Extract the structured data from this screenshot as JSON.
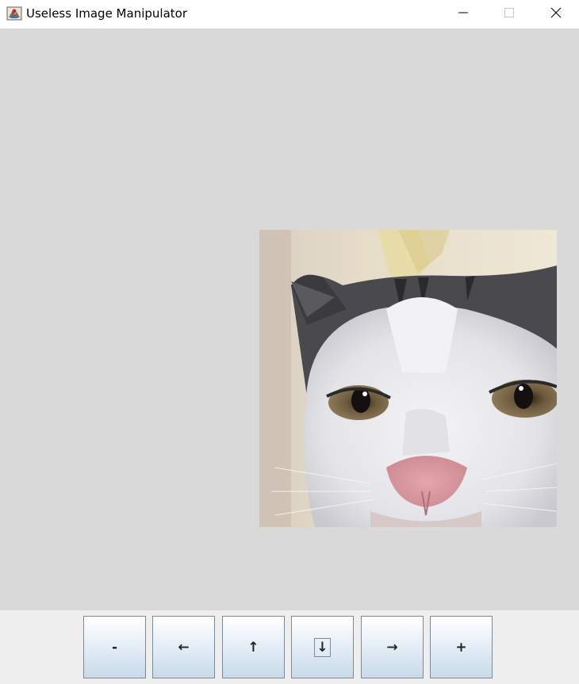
{
  "window": {
    "title": "Useless Image Manipulator",
    "controls": {
      "minimize_icon": "minimize-icon",
      "maximize_icon": "maximize-icon",
      "close_icon": "close-icon"
    }
  },
  "canvas": {
    "background": "#d9d9d9",
    "image": "cat-photo"
  },
  "toolbar": {
    "buttons": [
      {
        "label": "-",
        "action": "zoom-out"
      },
      {
        "label": "←",
        "action": "move-left"
      },
      {
        "label": "↑",
        "action": "move-up"
      },
      {
        "label": "↓",
        "action": "move-down",
        "focused": true
      },
      {
        "label": "→",
        "action": "move-right"
      },
      {
        "label": "+",
        "action": "zoom-in"
      }
    ]
  },
  "colors": {
    "button_gradient_top": "#ffffff",
    "button_gradient_bottom": "#c8daea",
    "button_border": "#7a8a99",
    "toolbar_bg": "#eeeeee"
  }
}
